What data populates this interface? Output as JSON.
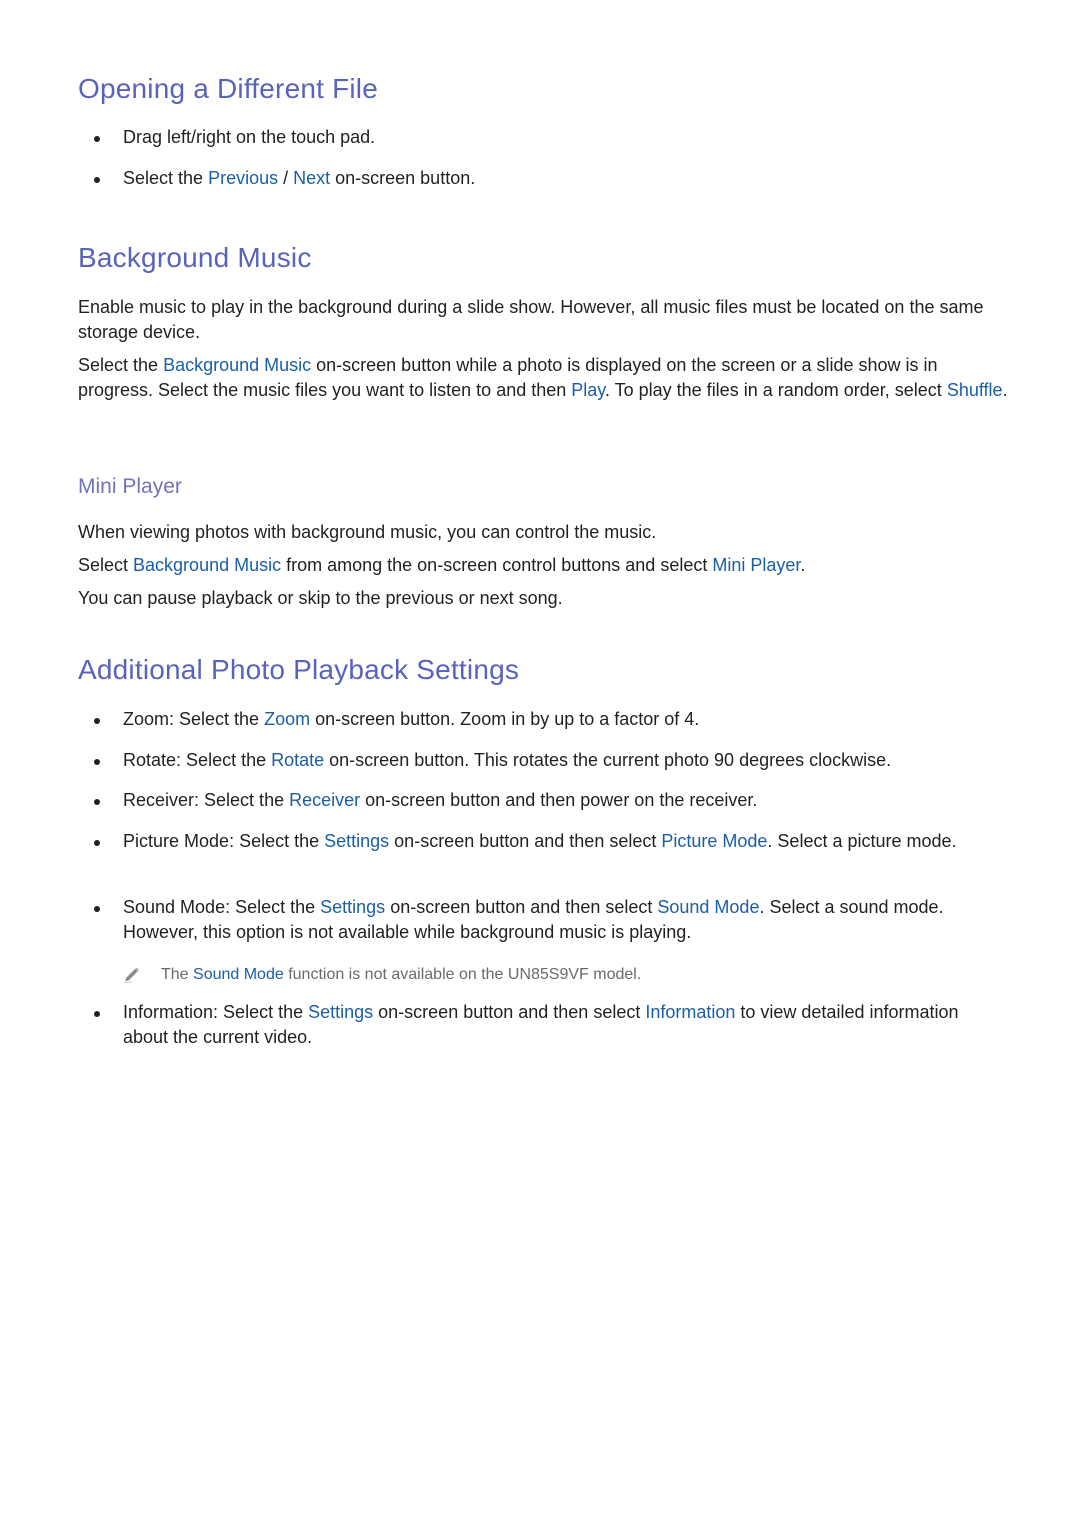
{
  "sections": {
    "opening": {
      "title": "Opening a Different File",
      "bullets": [
        {
          "text": "Drag left/right on the touch pad."
        },
        {
          "pre": "Select the ",
          "link1": "Previous",
          "mid": " / ",
          "link2": "Next",
          "post": " on-screen button."
        }
      ]
    },
    "background_music": {
      "title": "Background Music",
      "para1": "Enable music to play in the background during a slide show. However, all music files must be located on the same storage device.",
      "para2": {
        "pre": "Select the ",
        "link1": "Background Music",
        "mid1": " on-screen button while a photo is displayed on the screen or a slide show is in progress. Select the music files you want to listen to and then ",
        "link2": "Play",
        "mid2": ". To play the files in a random order, select ",
        "link3": "Shuffle",
        "post": "."
      },
      "mini_player": {
        "title": "Mini Player",
        "line1": "When viewing photos with background music, you can control the music.",
        "line2": {
          "pre": "Select ",
          "link1": "Background Music",
          "mid": " from among the on-screen control buttons and select ",
          "link2": "Mini Player",
          "post": "."
        },
        "line3": "You can pause playback or skip to the previous or next song."
      }
    },
    "additional": {
      "title": "Additional Photo Playback Settings",
      "items": [
        {
          "term": "Zoom",
          "pre": ": Select the ",
          "link1": "Zoom",
          "post": " on-screen button. Zoom in by up to a factor of 4."
        },
        {
          "term": "Rotate",
          "pre": ": Select the ",
          "link1": "Rotate",
          "post": " on-screen button. This rotates the current photo 90 degrees clockwise."
        },
        {
          "term": "Receiver",
          "pre": ": Select the ",
          "link1": "Receiver",
          "post": " on-screen button and then power on the receiver."
        },
        {
          "term": "Picture Mode",
          "pre": ": Select the ",
          "link1": "Settings",
          "mid": " on-screen button and then select ",
          "link2": "Picture Mode",
          "post": ". Select a picture mode."
        },
        {
          "term": "Sound Mode",
          "pre": ": Select the ",
          "link1": "Settings",
          "mid": " on-screen button and then select ",
          "link2": "Sound Mode",
          "post": ". Select a sound mode. However, this option is not available while background music is playing."
        },
        {
          "term": "Information",
          "pre": ": Select the ",
          "link1": "Settings",
          "mid": " on-screen button and then select ",
          "link2": "Information",
          "post": " to view detailed information about the current video."
        }
      ],
      "note": {
        "icon": "pencil-icon",
        "pre": "The ",
        "link": "Sound Mode",
        "post": " function is not available on the UN85S9VF model."
      }
    }
  },
  "colors": {
    "heading": "#5a63bb",
    "subheading": "#6f74b9",
    "link": "#1a5ea8",
    "body": "#231f20",
    "note": "#6a6a6a"
  }
}
